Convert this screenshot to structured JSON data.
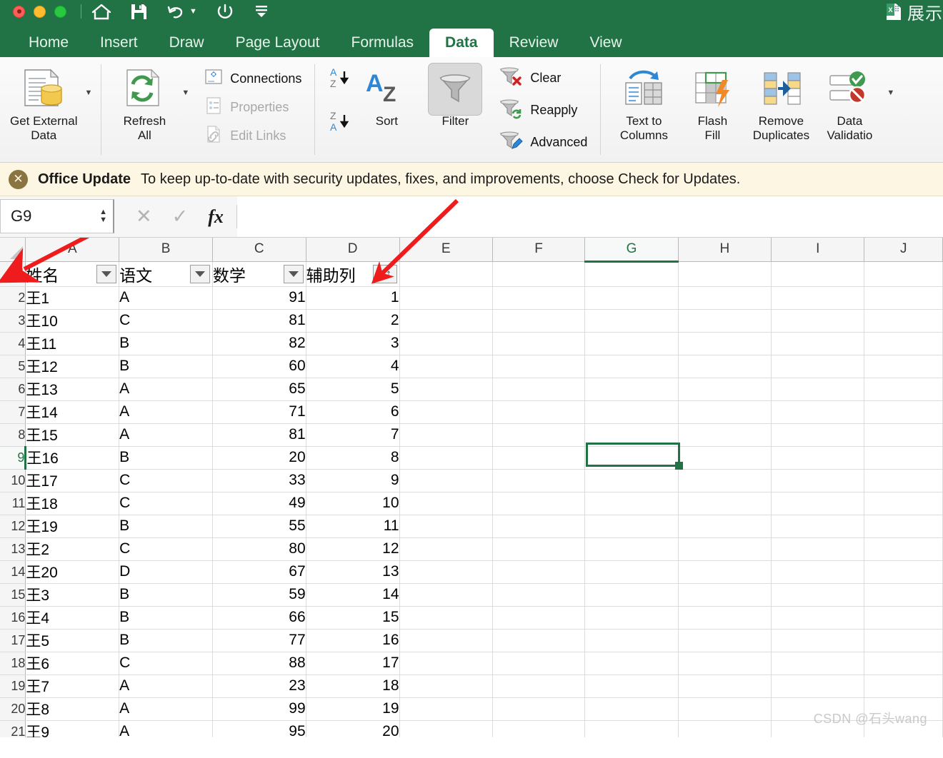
{
  "window": {
    "traffic_lights": [
      "close",
      "minimize",
      "maximize"
    ],
    "quick_access": [
      {
        "name": "home-icon",
        "label": "Home"
      },
      {
        "name": "save-icon",
        "label": "Save"
      },
      {
        "name": "undo-icon",
        "label": "Undo"
      },
      {
        "name": "redo-icon",
        "label": "Redo"
      },
      {
        "name": "customize-toolbar-icon",
        "label": "Customize Quick Access Toolbar"
      }
    ],
    "document_title": "展示",
    "file_icon": "excel-file-icon",
    "theme_color": "#217346"
  },
  "tabs": [
    {
      "label": "Home",
      "active": false
    },
    {
      "label": "Insert",
      "active": false
    },
    {
      "label": "Draw",
      "active": false
    },
    {
      "label": "Page Layout",
      "active": false
    },
    {
      "label": "Formulas",
      "active": false
    },
    {
      "label": "Data",
      "active": true
    },
    {
      "label": "Review",
      "active": false
    },
    {
      "label": "View",
      "active": false
    }
  ],
  "ribbon": {
    "get_external_data": {
      "label_line1": "Get External",
      "label_line2": "Data",
      "has_caret": true
    },
    "refresh_all": {
      "label_line1": "Refresh",
      "label_line2": "All",
      "has_caret": true
    },
    "connections_group": [
      {
        "label": "Connections",
        "icon": "connections-icon",
        "disabled": false
      },
      {
        "label": "Properties",
        "icon": "properties-icon",
        "disabled": true
      },
      {
        "label": "Edit Links",
        "icon": "edit-links-icon",
        "disabled": true
      }
    ],
    "sort_asc": {
      "label": "A to Z sort",
      "icon": "sort-az-icon"
    },
    "sort_desc": {
      "label": "Z to A sort",
      "icon": "sort-za-icon"
    },
    "sort": {
      "label": "Sort"
    },
    "filter": {
      "label": "Filter",
      "active": true
    },
    "filter_group": [
      {
        "label": "Clear",
        "icon": "clear-filter-icon"
      },
      {
        "label": "Reapply",
        "icon": "reapply-filter-icon"
      },
      {
        "label": "Advanced",
        "icon": "advanced-filter-icon"
      }
    ],
    "text_to_columns": {
      "label_line1": "Text to",
      "label_line2": "Columns"
    },
    "flash_fill": {
      "label_line1": "Flash",
      "label_line2": "Fill"
    },
    "remove_duplicates": {
      "label_line1": "Remove",
      "label_line2": "Duplicates"
    },
    "data_validation": {
      "label_line1": "Data",
      "label_line2": "Validatio",
      "has_caret": true
    }
  },
  "notification": {
    "close_icon": "close-icon",
    "title": "Office Update",
    "message": "To keep up-to-date with security updates, fixes, and improvements, choose Check for Updates.",
    "background": "#fdf6e3"
  },
  "formula_bar": {
    "name_box_value": "G9",
    "cancel_icon": "cancel-icon",
    "confirm_icon": "confirm-icon",
    "function_icon": "fx-icon",
    "formula_value": ""
  },
  "sheet": {
    "columns": [
      "A",
      "B",
      "C",
      "D",
      "E",
      "F",
      "G",
      "H",
      "I",
      "J"
    ],
    "active_column": "G",
    "active_row": 9,
    "selected_cell": "G9",
    "header_row": {
      "row_number": "1",
      "cells": [
        {
          "text": "姓名",
          "filter": "dropdown"
        },
        {
          "text": "语文",
          "filter": "dropdown"
        },
        {
          "text": "数学",
          "filter": "dropdown"
        },
        {
          "text": "辅助列",
          "filter": "dropdown-sorted-asc"
        }
      ]
    },
    "rows": [
      {
        "n": "2",
        "a": "王1",
        "b": "A",
        "c": "91",
        "d": "1"
      },
      {
        "n": "3",
        "a": "王10",
        "b": "C",
        "c": "81",
        "d": "2"
      },
      {
        "n": "4",
        "a": "王11",
        "b": "B",
        "c": "82",
        "d": "3"
      },
      {
        "n": "5",
        "a": "王12",
        "b": "B",
        "c": "60",
        "d": "4"
      },
      {
        "n": "6",
        "a": "王13",
        "b": "A",
        "c": "65",
        "d": "5"
      },
      {
        "n": "7",
        "a": "王14",
        "b": "A",
        "c": "71",
        "d": "6"
      },
      {
        "n": "8",
        "a": "王15",
        "b": "A",
        "c": "81",
        "d": "7"
      },
      {
        "n": "9",
        "a": "王16",
        "b": "B",
        "c": "20",
        "d": "8"
      },
      {
        "n": "10",
        "a": "王17",
        "b": "C",
        "c": "33",
        "d": "9"
      },
      {
        "n": "11",
        "a": "王18",
        "b": "C",
        "c": "49",
        "d": "10"
      },
      {
        "n": "12",
        "a": "王19",
        "b": "B",
        "c": "55",
        "d": "11"
      },
      {
        "n": "13",
        "a": "王2",
        "b": "C",
        "c": "80",
        "d": "12"
      },
      {
        "n": "14",
        "a": "王20",
        "b": "D",
        "c": "67",
        "d": "13"
      },
      {
        "n": "15",
        "a": "王3",
        "b": "B",
        "c": "59",
        "d": "14"
      },
      {
        "n": "16",
        "a": "王4",
        "b": "B",
        "c": "66",
        "d": "15"
      },
      {
        "n": "17",
        "a": "王5",
        "b": "B",
        "c": "77",
        "d": "16"
      },
      {
        "n": "18",
        "a": "王6",
        "b": "C",
        "c": "88",
        "d": "17"
      },
      {
        "n": "19",
        "a": "王7",
        "b": "A",
        "c": "23",
        "d": "18"
      },
      {
        "n": "20",
        "a": "王8",
        "b": "A",
        "c": "99",
        "d": "19"
      },
      {
        "n": "21",
        "a": "王9",
        "b": "A",
        "c": "95",
        "d": "20"
      }
    ]
  },
  "annotation": {
    "arrow_color": "#ee1c1c",
    "points_to": "column-D-filter-dropdown"
  },
  "watermark": "CSDN @石头wang"
}
